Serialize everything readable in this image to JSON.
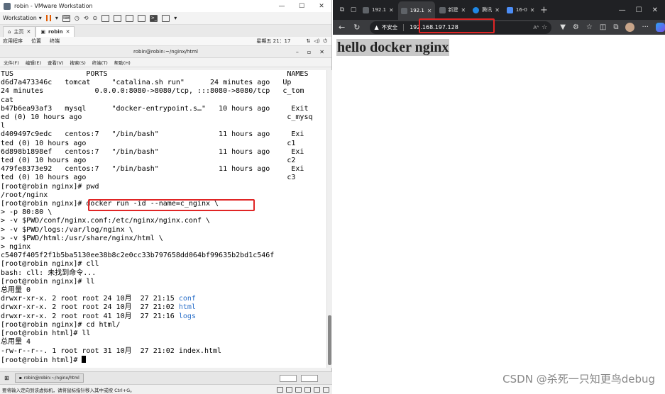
{
  "vmware": {
    "title": "robin - VMware Workstation",
    "workspace_label": "Workstation",
    "tabs": [
      {
        "label": "主页"
      },
      {
        "label": "robin"
      }
    ],
    "appbar": {
      "apps": "应用程序",
      "places": "位置",
      "terminal": "终端",
      "clock": "星期五 21：17"
    },
    "terminal_title": "robin@robin:~/nginx/html",
    "terminal_menu": [
      "文件(F)",
      "编辑(E)",
      "查看(V)",
      "搜索(S)",
      "终端(T)",
      "帮助(H)"
    ],
    "terminal_lines": [
      "TUS                 PORTS                                          NAMES",
      "d6d7a473346c   tomcat     \"catalina.sh run\"      24 minutes ago   Up",
      "24 minutes            0.0.0.0:8080->8080/tcp, :::8080->8080/tcp   c_tom",
      "cat",
      "b47b6ea93af3   mysql      \"docker-entrypoint.s…\"   10 hours ago     Exit",
      "ed (0) 10 hours ago                                                c_mysq",
      "l",
      "d409497c9edc   centos:7   \"/bin/bash\"              11 hours ago     Exi",
      "ted (0) 10 hours ago                                               c1",
      "6d898b1898ef   centos:7   \"/bin/bash\"              11 hours ago     Exi",
      "ted (0) 10 hours ago                                               c2",
      "479fe8373e92   centos:7   \"/bin/bash\"              11 hours ago     Exi",
      "ted (0) 10 hours ago                                               c3",
      "[root@robin nginx]# pwd",
      "/root/nginx",
      "[root@robin nginx]# docker run -id --name=c_nginx \\",
      "> -p 80:80 \\",
      "> -v $PWD/conf/nginx.conf:/etc/nginx/nginx.conf \\",
      "> -v $PWD/logs:/var/log/nginx \\",
      "> -v $PWD/html:/usr/share/nginx/html \\",
      "> nginx",
      "c5407f405f2f1b5ba5130ee38b8c2e0cc33b797658dd064bf99635b2bd1c546f",
      "[root@robin nginx]# cll",
      "bash: cll: 未找到命令...",
      "[root@robin nginx]# ll",
      "总用量 0"
    ],
    "ls_rows": [
      {
        "prefix": "drwxr-xr-x. 2 root root 24 10月  27 21:15 ",
        "name": "conf"
      },
      {
        "prefix": "drwxr-xr-x. 2 root root 24 10月  27 21:02 ",
        "name": "html"
      },
      {
        "prefix": "drwxr-xr-x. 2 root root 41 10月  27 21:16 ",
        "name": "logs"
      }
    ],
    "terminal_tail": [
      "[root@robin nginx]# cd html/",
      "[root@robin html]# ll",
      "总用量 4",
      "-rw-r--r--. 1 root root 31 10月  27 21:02 index.html",
      "[root@robin html]# "
    ],
    "taskbar_item": "robin@robin:~/nginx/html",
    "status_text": "要将输入定向到该虚拟机，请将鼠标指针移入其中或按 Ctrl+G。"
  },
  "edge": {
    "tabs": [
      {
        "label": "192.1",
        "icon": "page-icon"
      },
      {
        "label": "192.1",
        "icon": "page-icon",
        "active": true
      },
      {
        "label": "新建",
        "icon": "newtab-icon"
      },
      {
        "label": "腾讯",
        "icon": "edge-icon"
      },
      {
        "label": "16-0",
        "icon": "page-icon"
      }
    ],
    "address": {
      "security_label": "不安全",
      "url": "192.168.197.128",
      "aa": "Aᴬ"
    },
    "page_heading": "hello docker nginx",
    "watermark": "CSDN @杀死一只知更鸟debug"
  },
  "colors": {
    "highlight_border": "#e02525",
    "ls_dir": "#2a6fc9",
    "edge_chrome": "#202124"
  }
}
